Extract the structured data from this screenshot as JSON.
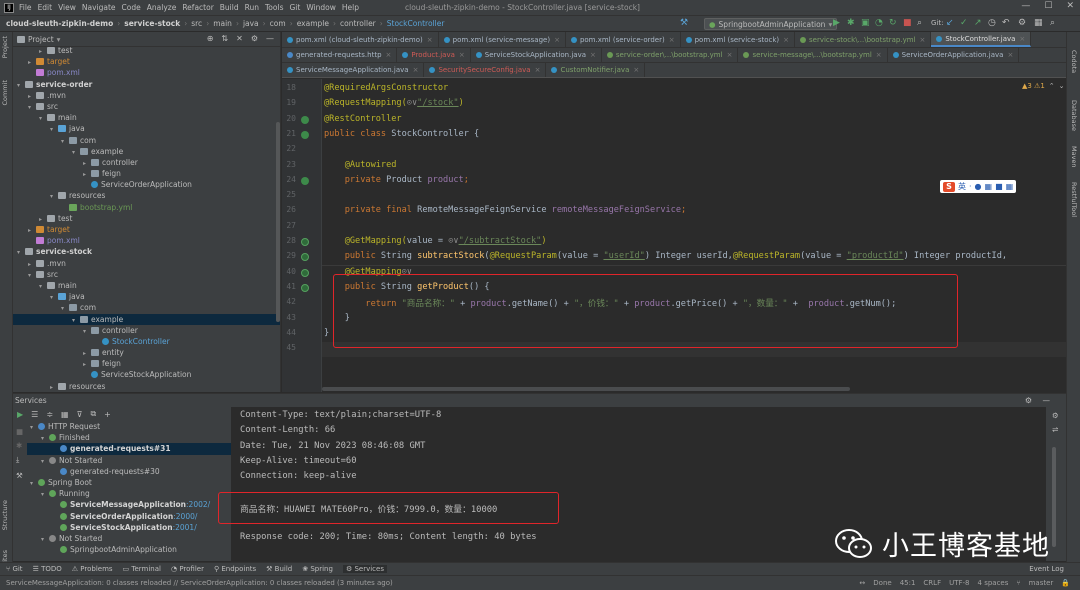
{
  "menubar": {
    "items": [
      "File",
      "Edit",
      "View",
      "Navigate",
      "Code",
      "Analyze",
      "Refactor",
      "Build",
      "Run",
      "Tools",
      "Git",
      "Window",
      "Help"
    ],
    "window_title": "cloud-sleuth-zipkin-demo - StockController.java [service-stock]"
  },
  "navbar": {
    "crumbs": [
      "cloud-sleuth-zipkin-demo",
      "service-stock",
      "src",
      "main",
      "java",
      "com",
      "example",
      "controller",
      "StockController"
    ],
    "run_config": "SpringbootAdminApplication",
    "git_label": "Git:"
  },
  "project": {
    "title": "Project",
    "rows": [
      {
        "indent": 2,
        "arrow": "▸",
        "icon": "folder",
        "text": "test",
        "cls": ""
      },
      {
        "indent": 1,
        "arrow": "▸",
        "icon": "orange",
        "text": "target",
        "cls": "t-excl"
      },
      {
        "indent": 1,
        "arrow": "",
        "icon": "xml",
        "text": "pom.xml",
        "cls": "t-pom"
      },
      {
        "indent": 0,
        "arrow": "▾",
        "icon": "folder",
        "text": "service-order",
        "cls": "t-mod"
      },
      {
        "indent": 1,
        "arrow": "▸",
        "icon": "folder",
        "text": ".mvn",
        "cls": ""
      },
      {
        "indent": 1,
        "arrow": "▾",
        "icon": "folder",
        "text": "src",
        "cls": ""
      },
      {
        "indent": 2,
        "arrow": "▾",
        "icon": "folder",
        "text": "main",
        "cls": ""
      },
      {
        "indent": 3,
        "arrow": "▾",
        "icon": "blue",
        "text": "java",
        "cls": ""
      },
      {
        "indent": 4,
        "arrow": "▾",
        "icon": "pkg",
        "text": "com",
        "cls": ""
      },
      {
        "indent": 5,
        "arrow": "▾",
        "icon": "pkg",
        "text": "example",
        "cls": ""
      },
      {
        "indent": 6,
        "arrow": "▸",
        "icon": "pkg",
        "text": "controller",
        "cls": ""
      },
      {
        "indent": 6,
        "arrow": "▸",
        "icon": "pkg",
        "text": "feign",
        "cls": ""
      },
      {
        "indent": 6,
        "arrow": "",
        "icon": "cls",
        "text": "ServiceOrderApplication",
        "cls": ""
      },
      {
        "indent": 3,
        "arrow": "▾",
        "icon": "folder",
        "text": "resources",
        "cls": ""
      },
      {
        "indent": 4,
        "arrow": "",
        "icon": "yml",
        "text": "bootstrap.yml",
        "cls": "t-yml"
      },
      {
        "indent": 2,
        "arrow": "▸",
        "icon": "folder",
        "text": "test",
        "cls": ""
      },
      {
        "indent": 1,
        "arrow": "▸",
        "icon": "orange",
        "text": "target",
        "cls": "t-excl"
      },
      {
        "indent": 1,
        "arrow": "",
        "icon": "xml",
        "text": "pom.xml",
        "cls": "t-pom"
      },
      {
        "indent": 0,
        "arrow": "▾",
        "icon": "folder",
        "text": "service-stock",
        "cls": "t-mod"
      },
      {
        "indent": 1,
        "arrow": "▸",
        "icon": "folder",
        "text": ".mvn",
        "cls": ""
      },
      {
        "indent": 1,
        "arrow": "▾",
        "icon": "folder",
        "text": "src",
        "cls": ""
      },
      {
        "indent": 2,
        "arrow": "▾",
        "icon": "folder",
        "text": "main",
        "cls": ""
      },
      {
        "indent": 3,
        "arrow": "▾",
        "icon": "blue",
        "text": "java",
        "cls": ""
      },
      {
        "indent": 4,
        "arrow": "▾",
        "icon": "pkg",
        "text": "com",
        "cls": ""
      },
      {
        "indent": 5,
        "arrow": "▾",
        "icon": "pkg",
        "text": "example",
        "cls": "",
        "sel": true
      },
      {
        "indent": 6,
        "arrow": "▾",
        "icon": "pkg",
        "text": "controller",
        "cls": ""
      },
      {
        "indent": 7,
        "arrow": "",
        "icon": "cls",
        "text": "StockController",
        "cls": "s-port"
      },
      {
        "indent": 6,
        "arrow": "▸",
        "icon": "pkg",
        "text": "entity",
        "cls": ""
      },
      {
        "indent": 6,
        "arrow": "▸",
        "icon": "pkg",
        "text": "feign",
        "cls": ""
      },
      {
        "indent": 6,
        "arrow": "",
        "icon": "cls",
        "text": "ServiceStockApplication",
        "cls": ""
      },
      {
        "indent": 3,
        "arrow": "▸",
        "icon": "folder",
        "text": "resources",
        "cls": ""
      }
    ]
  },
  "tabs": {
    "row1": [
      {
        "label": "pom.xml (cloud-sleuth-zipkin-demo)",
        "cls": ""
      },
      {
        "label": "pom.xml (service-message)",
        "cls": ""
      },
      {
        "label": "pom.xml (service-order)",
        "cls": ""
      },
      {
        "label": "pom.xml (service-stock)",
        "cls": ""
      },
      {
        "label": "service-stock\\...\\bootstrap.yml",
        "cls": "green"
      },
      {
        "label": "StockController.java",
        "cls": "active"
      }
    ],
    "row2": [
      {
        "label": "generated-requests.http",
        "cls": ""
      },
      {
        "label": "Product.java",
        "cls": "red"
      },
      {
        "label": "ServiceStockApplication.java",
        "cls": ""
      },
      {
        "label": "service-order\\...\\bootstrap.yml",
        "cls": "green"
      },
      {
        "label": "service-message\\...\\bootstrap.yml",
        "cls": "green"
      },
      {
        "label": "ServiceOrderApplication.java",
        "cls": ""
      }
    ],
    "row3": [
      {
        "label": "ServiceMessageApplication.java",
        "cls": ""
      },
      {
        "label": "SecuritySecureConfig.java",
        "cls": "red"
      },
      {
        "label": "CustomNotifier.java",
        "cls": "green"
      }
    ]
  },
  "editor": {
    "inspections": "▲3  ⚠1",
    "line_numbers": [
      "18",
      "19",
      "20",
      "21",
      "22",
      "23",
      "24",
      "25",
      "26",
      "27",
      "28",
      "29",
      "40",
      "41",
      "42",
      "43",
      "44",
      "45"
    ],
    "lines": [
      [
        {
          "t": "@RequiredArgsConstructor",
          "c": "an"
        }
      ],
      [
        {
          "t": "@RequestMapping(",
          "c": "an"
        },
        {
          "t": "⊙∨",
          "c": "ggl"
        },
        {
          "t": "\"/stock\"",
          "c": "stu"
        },
        {
          "t": ")",
          "c": "an"
        }
      ],
      [
        {
          "t": "@RestController",
          "c": "an"
        }
      ],
      [
        {
          "t": "public class ",
          "c": "kw"
        },
        {
          "t": "StockController {",
          "c": "pm"
        }
      ],
      [
        {
          "t": "",
          "c": "pm"
        }
      ],
      [
        {
          "t": "    @Autowired",
          "c": "an"
        }
      ],
      [
        {
          "t": "    private ",
          "c": "kw"
        },
        {
          "t": "Product ",
          "c": "pm"
        },
        {
          "t": "product",
          "c": "fld"
        },
        {
          "t": ";",
          "c": "kw"
        }
      ],
      [
        {
          "t": "",
          "c": "pm"
        }
      ],
      [
        {
          "t": "    private final ",
          "c": "kw"
        },
        {
          "t": "RemoteMessageFeignService ",
          "c": "pm"
        },
        {
          "t": "remoteMessageFeignService",
          "c": "fld"
        },
        {
          "t": ";",
          "c": "kw"
        }
      ],
      [
        {
          "t": "",
          "c": "pm"
        }
      ],
      [
        {
          "t": "    @GetMapping(",
          "c": "an"
        },
        {
          "t": "value = ",
          "c": "pm"
        },
        {
          "t": "⊙∨",
          "c": "ggl"
        },
        {
          "t": "\"/subtractStock\"",
          "c": "stu"
        },
        {
          "t": ")",
          "c": "an"
        }
      ],
      [
        {
          "t": "    public ",
          "c": "kw"
        },
        {
          "t": "String ",
          "c": "pm"
        },
        {
          "t": "subtractStock",
          "c": "fn"
        },
        {
          "t": "(",
          "c": "pm"
        },
        {
          "t": "@RequestParam",
          "c": "an"
        },
        {
          "t": "(value = ",
          "c": "pm"
        },
        {
          "t": "\"userId\"",
          "c": "stu"
        },
        {
          "t": ") Integer userId,",
          "c": "pm"
        },
        {
          "t": "@RequestParam",
          "c": "an"
        },
        {
          "t": "(value = ",
          "c": "pm"
        },
        {
          "t": "\"productId\"",
          "c": "stu"
        },
        {
          "t": ") Integer productId,",
          "c": "pm"
        }
      ],
      [
        {
          "t": "    @GetMapping",
          "c": "an"
        },
        {
          "t": "⊙∨",
          "c": "ggl"
        }
      ],
      [
        {
          "t": "    public ",
          "c": "kw"
        },
        {
          "t": "String ",
          "c": "pm"
        },
        {
          "t": "getProduct",
          "c": "fn"
        },
        {
          "t": "() {",
          "c": "pm"
        }
      ],
      [
        {
          "t": "        return ",
          "c": "kw"
        },
        {
          "t": "\"商品名称：\" ",
          "c": "st"
        },
        {
          "t": "+ ",
          "c": "pm"
        },
        {
          "t": "product",
          "c": "fld"
        },
        {
          "t": ".getName() + ",
          "c": "pm"
        },
        {
          "t": "\"，价钱：\" ",
          "c": "st"
        },
        {
          "t": "+ ",
          "c": "pm"
        },
        {
          "t": "product",
          "c": "fld"
        },
        {
          "t": ".getPrice() + ",
          "c": "pm"
        },
        {
          "t": "\"，数量：\" ",
          "c": "st"
        },
        {
          "t": "+  ",
          "c": "pm"
        },
        {
          "t": "product",
          "c": "fld"
        },
        {
          "t": ".getNum();",
          "c": "pm"
        }
      ],
      [
        {
          "t": "    }",
          "c": "pm"
        }
      ],
      [
        {
          "t": "}",
          "c": "pm"
        }
      ],
      [
        {
          "t": "",
          "c": "pm"
        }
      ]
    ]
  },
  "services": {
    "title": "Services",
    "tree": [
      {
        "indent": 0,
        "arrow": "▾",
        "icon": "#4a88c7",
        "text": "HTTP Request",
        "cls": ""
      },
      {
        "indent": 1,
        "arrow": "▾",
        "icon": "#5fa55a",
        "text": "Finished",
        "cls": ""
      },
      {
        "indent": 2,
        "arrow": "",
        "icon": "#4a88c7",
        "text": "generated-requests#31",
        "cls": "s-bold",
        "sel": true
      },
      {
        "indent": 1,
        "arrow": "▾",
        "icon": "#888888",
        "text": "Not Started",
        "cls": ""
      },
      {
        "indent": 2,
        "arrow": "",
        "icon": "#4a88c7",
        "text": "generated-requests#30",
        "cls": ""
      },
      {
        "indent": 0,
        "arrow": "▾",
        "icon": "#5fa55a",
        "text": "Spring Boot",
        "cls": ""
      },
      {
        "indent": 1,
        "arrow": "▾",
        "icon": "#5fa55a",
        "text": "Running",
        "cls": ""
      },
      {
        "indent": 2,
        "arrow": "",
        "icon": "#5fa55a",
        "text": "ServiceMessageApplication",
        "port": ":2002/",
        "cls": "s-bold"
      },
      {
        "indent": 2,
        "arrow": "",
        "icon": "#5fa55a",
        "text": "ServiceOrderApplication",
        "port": ":2000/",
        "cls": "s-bold"
      },
      {
        "indent": 2,
        "arrow": "",
        "icon": "#5fa55a",
        "text": "ServiceStockApplication",
        "port": ":2001/",
        "cls": "s-bold"
      },
      {
        "indent": 1,
        "arrow": "▾",
        "icon": "#888888",
        "text": "Not Started",
        "cls": ""
      },
      {
        "indent": 2,
        "arrow": "",
        "icon": "#5fa55a",
        "text": "SpringbootAdminApplication",
        "cls": ""
      }
    ],
    "console": [
      "Content-Type: text/plain;charset=UTF-8",
      "Content-Length: 66",
      "Date: Tue, 21 Nov 2023 08:46:08 GMT",
      "Keep-Alive: timeout=60",
      "Connection: keep-alive",
      "",
      "商品名称：HUAWEI MATE60Pro，价钱：7999.0，数量：10000",
      "",
      "Response code: 200; Time: 80ms; Content length: 40 bytes"
    ]
  },
  "watermark": {
    "text": "小王博客基地"
  },
  "bottom_tabs": [
    "Git",
    "TODO",
    "Problems",
    "Terminal",
    "Profiler",
    "Endpoints",
    "Build",
    "Spring",
    "Services"
  ],
  "event_log": "Event Log",
  "status": {
    "message": "ServiceMessageApplication: 0 classes reloaded // ServiceOrderApplication: 0 classes reloaded (3 minutes ago)",
    "done": "Done",
    "position": "45:1",
    "line_sep": "CRLF",
    "encoding": "UTF-8",
    "indent": "4 spaces",
    "branch": "master"
  },
  "left_vtabs": [
    "Project",
    "Commit",
    "Structure",
    "Favorites"
  ],
  "right_vtabs": [
    "Codota",
    "Database",
    "Maven",
    "RestfulTool"
  ]
}
